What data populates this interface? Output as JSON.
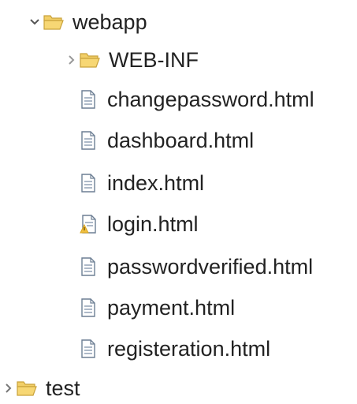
{
  "tree": {
    "webapp": {
      "label": "webapp",
      "state": "expanded",
      "icon": "folder-open-icon"
    },
    "web_inf": {
      "label": "WEB-INF",
      "state": "collapsed",
      "icon": "folder-open-icon"
    },
    "files": [
      {
        "label": "changepassword.html",
        "icon": "html-file-icon"
      },
      {
        "label": "dashboard.html",
        "icon": "html-file-icon"
      },
      {
        "label": "index.html",
        "icon": "html-file-icon"
      },
      {
        "label": "login.html",
        "icon": "html-file-warning-icon"
      },
      {
        "label": "passwordverified.html",
        "icon": "html-file-icon"
      },
      {
        "label": "payment.html",
        "icon": "html-file-icon"
      },
      {
        "label": "registeration.html",
        "icon": "html-file-icon"
      }
    ],
    "test": {
      "label": "test",
      "state": "collapsed",
      "icon": "folder-open-icon"
    }
  },
  "colors": {
    "text": "#222222",
    "chevron": "#555555",
    "chevron_faint": "#999999",
    "folder_fill": "#f7d774",
    "folder_stroke": "#c9a23a",
    "file_stroke": "#6d7f94",
    "warning": "#d9a520"
  }
}
